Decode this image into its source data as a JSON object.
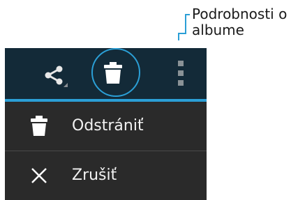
{
  "callout": {
    "text_line1": "Podrobnosti o",
    "text_line2": "albume",
    "color": "#2b9fd6"
  },
  "action_bar": {
    "background": "#132a38",
    "accent": "#2b9fd6",
    "icons": [
      "share-icon",
      "delete-icon",
      "overflow-menu-icon"
    ],
    "highlighted": "delete-icon"
  },
  "menu": {
    "background": "#2a2a2a",
    "items": [
      {
        "label": "Odstrániť",
        "icon": "trash-icon"
      },
      {
        "label": "Zrušiť",
        "icon": "close-icon"
      }
    ]
  }
}
